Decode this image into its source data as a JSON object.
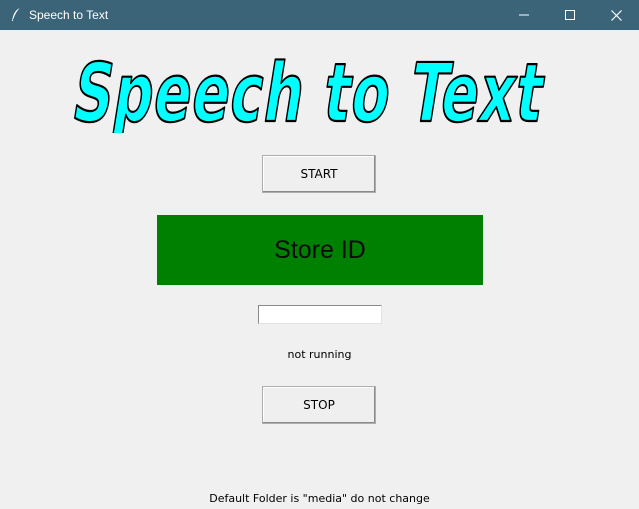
{
  "window": {
    "title": "Speech to Text",
    "titlebar_color": "#3c6478",
    "icon": "feather-icon",
    "controls": [
      "minimize-icon",
      "maximize-icon",
      "close-icon"
    ]
  },
  "logo": {
    "text": "Speech to Text",
    "fill_color": "#00ffff",
    "outline_color": "#000000"
  },
  "buttons": {
    "start_label": "START",
    "store_id_label": "Store ID",
    "store_id_color": "#008000",
    "stop_label": "STOP"
  },
  "id_input": {
    "value": ""
  },
  "status": {
    "text": "not running"
  },
  "footer": {
    "text": "Default Folder is \"media\" do not change"
  }
}
